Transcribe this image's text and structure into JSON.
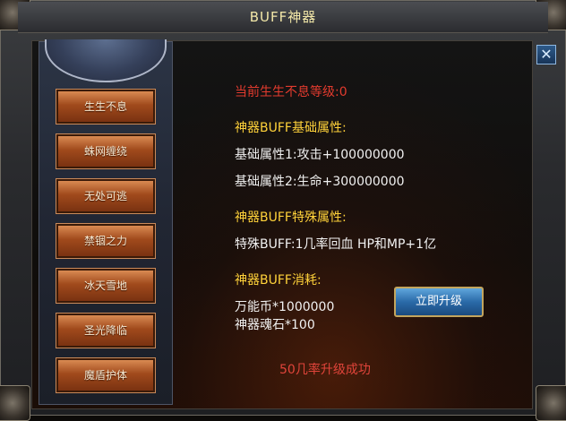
{
  "window": {
    "title": "BUFF神器",
    "close": "✕"
  },
  "menu": [
    "生生不息",
    "蛛网缠绕",
    "无处可逃",
    "禁锢之力",
    "冰天雪地",
    "圣光降临",
    "魔盾护体"
  ],
  "info": {
    "current_level": "当前生生不息等级:0",
    "base_title": "神器BUFF基础属性:",
    "base_attr1": "基础属性1:攻击+100000000",
    "base_attr2": "基础属性2:生命+300000000",
    "special_title": "神器BUFF特殊属性:",
    "special_attr": "特殊BUFF:1几率回血 HP和MP+1亿",
    "cost_title": "神器BUFF消耗:",
    "cost1": "万能币*1000000",
    "cost2": "神器魂石*100",
    "success_rate": "50几率升级成功"
  },
  "upgrade_button": "立即升级",
  "colors": {
    "red": "#e33b2e",
    "gold": "#ffd23a",
    "white": "#f1f1f1",
    "button_orange": "#a04a1c",
    "button_blue": "#2a6aa8"
  }
}
